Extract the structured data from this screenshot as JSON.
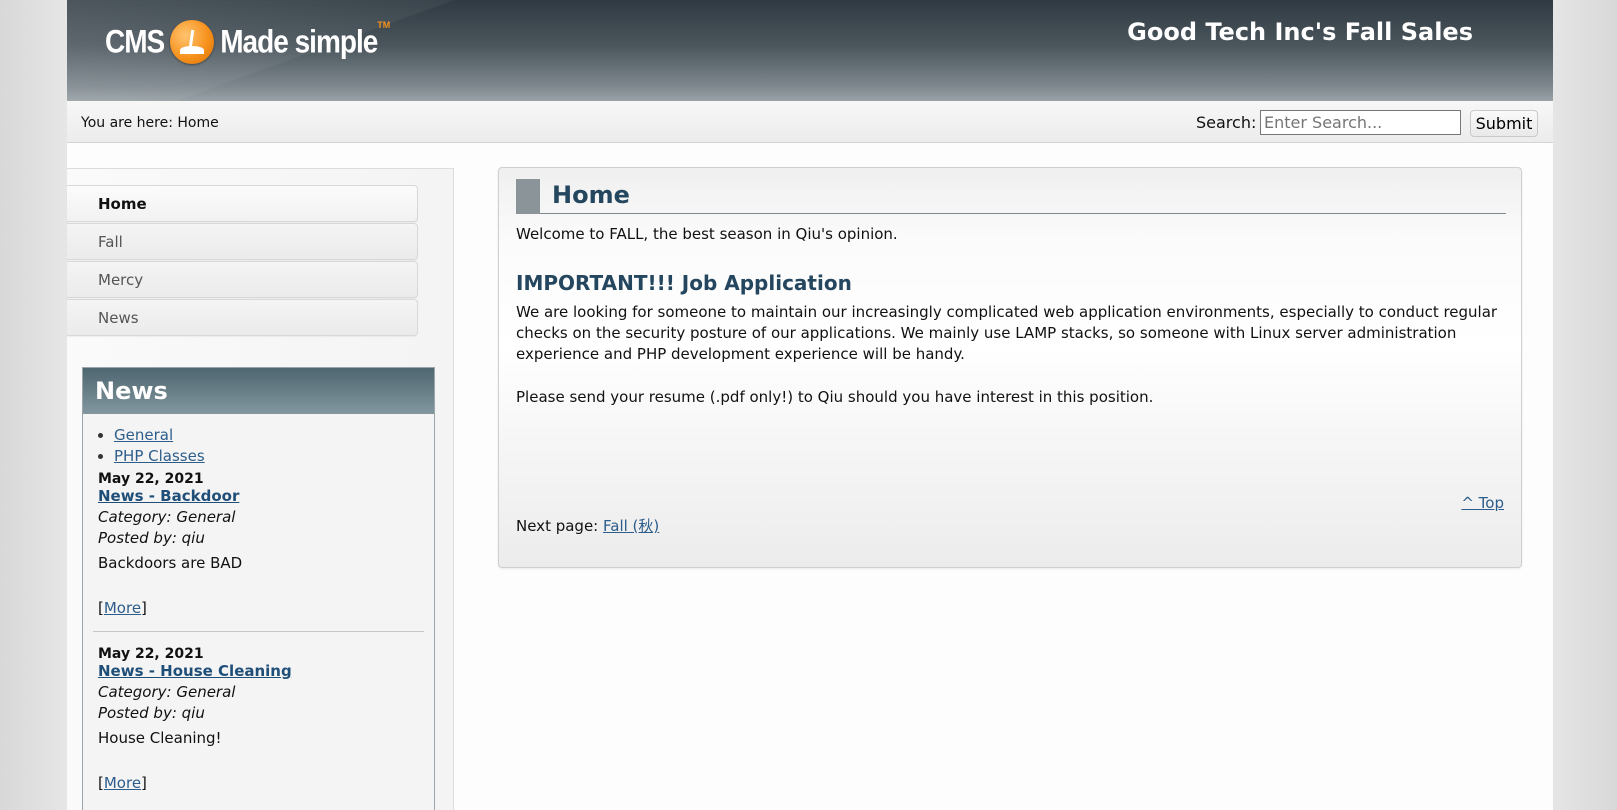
{
  "header": {
    "logo_left": "CMS",
    "logo_right": "Made simple",
    "logo_tm": "TM",
    "site_title": "Good Tech Inc's Fall Sales"
  },
  "breadcrumb": {
    "text": "You are here: Home"
  },
  "search": {
    "label": "Search:",
    "placeholder": "Enter Search...",
    "submit_label": "Submit"
  },
  "menu": {
    "items": [
      {
        "label": "Home"
      },
      {
        "label": "Fall"
      },
      {
        "label": "Mercy"
      },
      {
        "label": "News"
      }
    ]
  },
  "news": {
    "heading": "News",
    "categories": [
      "General",
      "PHP Classes"
    ],
    "entries": [
      {
        "date": "May 22, 2021",
        "title": "News - Backdoor",
        "category": "Category: General",
        "posted_by": "Posted by: qiu",
        "summary": "Backdoors are BAD",
        "more_prefix": "[",
        "more": "More",
        "more_suffix": "]"
      },
      {
        "date": "May 22, 2021",
        "title": "News - House Cleaning",
        "category": "Category: General",
        "posted_by": "Posted by: qiu",
        "summary": "House Cleaning!",
        "more_prefix": "[",
        "more": "More",
        "more_suffix": "]"
      }
    ]
  },
  "main": {
    "title": "Home",
    "welcome": "Welcome to FALL, the best season in Qiu's opinion.",
    "subheading": "IMPORTANT!!! Job Application",
    "para1_line1": "We are looking for someone to maintain our increasingly complicated web application environments, especially to conduct regular",
    "para1_line2": "checks on the security posture of our applications. We mainly use LAMP stacks, so someone with Linux server administration",
    "para1_line3": "experience and PHP development experience will be handy.",
    "para2": "Please send your resume (.pdf only!) to Qiu should you have interest in this position.",
    "top_link": "^ Top",
    "next_label": "Next page:",
    "next_link": "Fall (秋)"
  },
  "colors": {
    "heading": "#24465e",
    "link": "#2d5d8a",
    "logo_orange": "#f7921e"
  }
}
